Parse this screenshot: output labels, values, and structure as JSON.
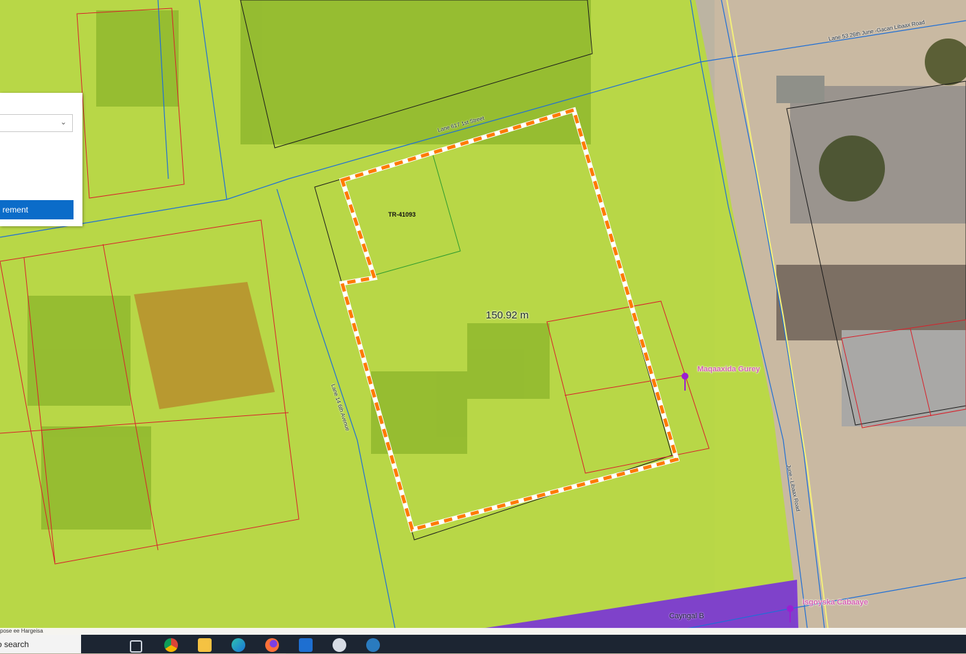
{
  "map": {
    "road_labels": {
      "lane_617": "Lane 617 1st Street",
      "lane_14": "Lane 14 6th Avenue",
      "lane_53": "Lane 53 26th June -Gacan Libaax Road",
      "june_libaax": "June - Libaax Road"
    },
    "parcel_id": "TR-41093",
    "measurement": "150.92 m",
    "pois": {
      "maqaaxida": "Maqaaxida Gurey",
      "isgoyska": "Isgoyska Cabaaye"
    },
    "area_label": "Cayngal B",
    "colors": {
      "zone_green": "#b7dc3a",
      "zone_purple": "#7a35d6",
      "parcel_red": "#d8202a",
      "boundary_blue": "#1f6fd6",
      "measure_orange": "#ff7a00"
    }
  },
  "panel": {
    "select_chevron": "chevron-down-icon",
    "button_label": "rement"
  },
  "attribution": "pose ee Hargeisa",
  "taskbar": {
    "search_text": "o search",
    "icons": [
      "task-view-icon",
      "chrome-icon",
      "file-explorer-icon",
      "edge-icon",
      "firefox-icon",
      "mail-icon",
      "satellite-icon",
      "app-icon"
    ]
  }
}
